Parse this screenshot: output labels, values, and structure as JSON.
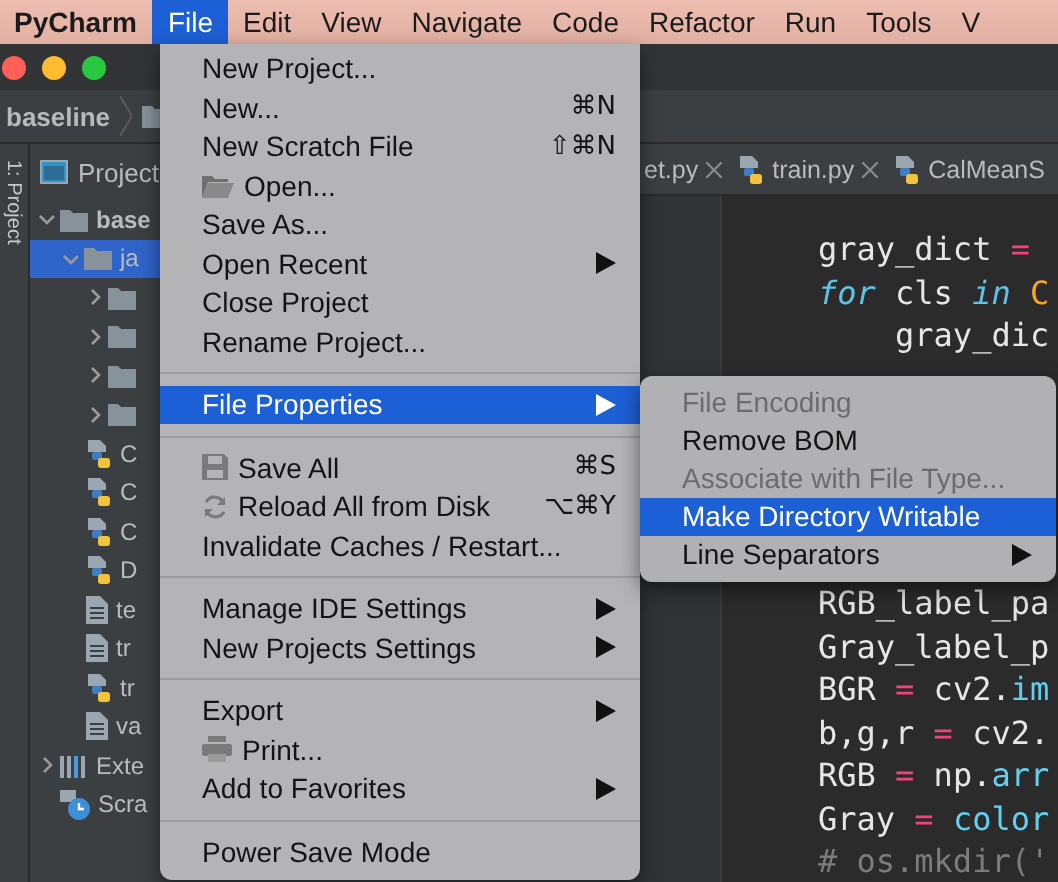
{
  "menu_bar": {
    "app_name": "PyCharm",
    "items": [
      {
        "label": "File",
        "selected": true
      },
      {
        "label": "Edit",
        "selected": false
      },
      {
        "label": "View",
        "selected": false
      },
      {
        "label": "Navigate",
        "selected": false
      },
      {
        "label": "Code",
        "selected": false
      },
      {
        "label": "Refactor",
        "selected": false
      },
      {
        "label": "Run",
        "selected": false
      },
      {
        "label": "Tools",
        "selected": false
      },
      {
        "label": "V",
        "selected": false
      }
    ]
  },
  "breadcrumb": {
    "label": "baseline"
  },
  "tool_window_label": "1: Project",
  "project_panel": {
    "title": "Project",
    "tree": [
      {
        "label": "base",
        "kind": "root",
        "expanded": true,
        "selected": false,
        "children": [
          {
            "label": "ja",
            "kind": "folder",
            "expanded": true,
            "selected": true,
            "children": [
              {
                "kind": "folder",
                "expanded": false,
                "selected": false
              },
              {
                "kind": "folder",
                "expanded": false,
                "selected": false
              },
              {
                "kind": "folder",
                "expanded": false,
                "selected": false
              },
              {
                "kind": "folder",
                "expanded": false,
                "selected": false
              },
              {
                "label": "C",
                "kind": "python",
                "selected": false
              },
              {
                "label": "C",
                "kind": "python",
                "selected": false
              },
              {
                "label": "C",
                "kind": "python",
                "selected": false
              },
              {
                "label": "D",
                "kind": "python",
                "selected": false
              },
              {
                "label": "te",
                "kind": "text",
                "selected": false
              },
              {
                "label": "tr",
                "kind": "text",
                "selected": false
              },
              {
                "label": "tr",
                "kind": "python",
                "selected": false
              },
              {
                "label": "va",
                "kind": "text",
                "selected": false
              }
            ]
          }
        ]
      },
      {
        "label": "Exte",
        "kind": "library",
        "expanded": false,
        "selected": false
      },
      {
        "label": "Scra",
        "kind": "scratch",
        "selected": false
      }
    ]
  },
  "editor_tabs": [
    {
      "label": "et.py",
      "kind": "plain",
      "closable": true
    },
    {
      "label": "train.py",
      "kind": "python",
      "closable": true
    },
    {
      "label": "CalMeanS",
      "kind": "python",
      "closable": false
    }
  ],
  "code_lines": [
    {
      "tokens": [
        {
          "text": "gray_dict ",
          "kind": "plain"
        },
        {
          "text": "=",
          "kind": "operator"
        }
      ]
    },
    {
      "tokens": [
        {
          "text": "for",
          "kind": "keyword"
        },
        {
          "text": " cls ",
          "kind": "plain"
        },
        {
          "text": "in",
          "kind": "keyword"
        },
        {
          "text": " C",
          "kind": "class"
        }
      ]
    },
    {
      "tokens": [
        {
          "text": "    gray_dic",
          "kind": "plain"
        }
      ]
    },
    {
      "tokens": [
        {
          "text": "RGB_label_pa",
          "kind": "plain"
        }
      ]
    },
    {
      "tokens": [
        {
          "text": "Gray_label_p",
          "kind": "plain"
        }
      ]
    },
    {
      "tokens": [
        {
          "text": "BGR ",
          "kind": "plain"
        },
        {
          "text": "=",
          "kind": "operator"
        },
        {
          "text": " cv2.",
          "kind": "plain"
        },
        {
          "text": "im",
          "kind": "call"
        }
      ]
    },
    {
      "tokens": [
        {
          "text": "b,g,r ",
          "kind": "plain"
        },
        {
          "text": "=",
          "kind": "operator"
        },
        {
          "text": " cv2.",
          "kind": "plain"
        }
      ]
    },
    {
      "tokens": [
        {
          "text": "RGB ",
          "kind": "plain"
        },
        {
          "text": "=",
          "kind": "operator"
        },
        {
          "text": " np.",
          "kind": "plain"
        },
        {
          "text": "arr",
          "kind": "call"
        }
      ]
    },
    {
      "tokens": [
        {
          "text": "Gray ",
          "kind": "plain"
        },
        {
          "text": "=",
          "kind": "operator"
        },
        {
          "text": " color",
          "kind": "call"
        }
      ]
    },
    {
      "tokens": [
        {
          "text": "# os.mkdir('",
          "kind": "comment"
        }
      ]
    }
  ],
  "file_menu": {
    "items": [
      {
        "kind": "item",
        "label": "New Project...",
        "selected": false
      },
      {
        "kind": "item",
        "label": "New...",
        "shortcut": "⌘N",
        "selected": false
      },
      {
        "kind": "item",
        "label": "New Scratch File",
        "shortcut": "⇧⌘N",
        "selected": false
      },
      {
        "kind": "folder_item",
        "label": "Open...",
        "selected": false
      },
      {
        "kind": "item",
        "label": "Save As...",
        "selected": false
      },
      {
        "kind": "item",
        "label": "Open Recent",
        "submenu": true,
        "selected": false
      },
      {
        "kind": "item",
        "label": "Close Project",
        "selected": false
      },
      {
        "kind": "item",
        "label": "Rename Project...",
        "selected": false
      },
      {
        "kind": "separator"
      },
      {
        "kind": "item",
        "label": "File Properties",
        "submenu": true,
        "selected": true
      },
      {
        "kind": "separator"
      },
      {
        "kind": "save_item",
        "label": "Save All",
        "shortcut": "⌘S",
        "selected": false
      },
      {
        "kind": "reload_item",
        "label": "Reload All from Disk",
        "shortcut": "⌥⌘Y",
        "selected": false
      },
      {
        "kind": "item",
        "label": "Invalidate Caches / Restart...",
        "selected": false
      },
      {
        "kind": "separator"
      },
      {
        "kind": "item",
        "label": "Manage IDE Settings",
        "submenu": true,
        "selected": false
      },
      {
        "kind": "item",
        "label": "New Projects Settings",
        "submenu": true,
        "selected": false
      },
      {
        "kind": "separator"
      },
      {
        "kind": "item",
        "label": "Export",
        "submenu": true,
        "selected": false
      },
      {
        "kind": "print_item",
        "label": "Print...",
        "selected": false
      },
      {
        "kind": "item",
        "label": "Add to Favorites",
        "submenu": true,
        "selected": false
      },
      {
        "kind": "separator"
      },
      {
        "kind": "item",
        "label": "Power Save Mode",
        "selected": false
      }
    ]
  },
  "file_properties_submenu": {
    "items": [
      {
        "label": "File Encoding",
        "disabled": true,
        "selected": false
      },
      {
        "label": "Remove BOM",
        "disabled": false,
        "selected": false
      },
      {
        "label": "Associate with File Type...",
        "disabled": true,
        "selected": false
      },
      {
        "label": "Make Directory Writable",
        "disabled": false,
        "selected": true
      },
      {
        "label": "Line Separators",
        "disabled": false,
        "submenu": true,
        "selected": false
      }
    ]
  }
}
